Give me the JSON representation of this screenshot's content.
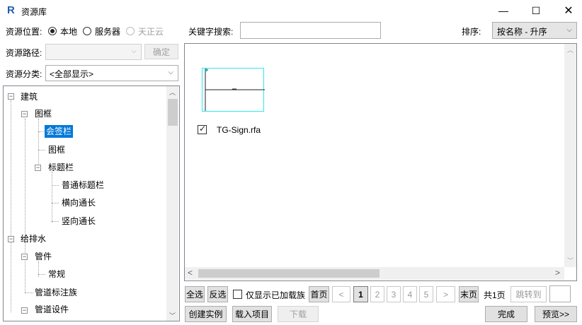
{
  "window": {
    "title": "资源库",
    "minimize": "—",
    "maximize": "☐",
    "close": "✕"
  },
  "location": {
    "label": "资源位置:",
    "options": [
      "本地",
      "服务器",
      "天正云"
    ],
    "selected": "本地"
  },
  "path": {
    "label": "资源路径:",
    "value": "",
    "confirm_label": "确定"
  },
  "category": {
    "label": "资源分类:",
    "value": "<全部显示>"
  },
  "tree": {
    "nodes": [
      {
        "label": "建筑",
        "expander": "⊟"
      },
      {
        "label": "图框",
        "expander": "⊟"
      },
      {
        "label": "会签栏"
      },
      {
        "label": "图框"
      },
      {
        "label": "标题栏",
        "expander": "⊟"
      },
      {
        "label": "普通标题栏"
      },
      {
        "label": "横向通长"
      },
      {
        "label": "竖向通长"
      },
      {
        "label": "给排水",
        "expander": "⊟"
      },
      {
        "label": "管件",
        "expander": "⊟"
      },
      {
        "label": "常规"
      },
      {
        "label": "管道标注族"
      },
      {
        "label": "管道设件"
      }
    ]
  },
  "search": {
    "label": "关键字搜索:",
    "value": ""
  },
  "sort": {
    "label": "排序:",
    "value": "按名称 - 升序"
  },
  "items": [
    {
      "filename": "TG-Sign.rfa",
      "checked": true
    }
  ],
  "pager": {
    "select_all": "全选",
    "invert": "反选",
    "only_loaded_label": "仅显示已加载族",
    "first": "首页",
    "prev": "<",
    "pages": [
      "1",
      "2",
      "3",
      "4",
      "5"
    ],
    "current_page": "1",
    "next": ">",
    "last": "末页",
    "total": "共1页",
    "jump": "跳转到"
  },
  "actions": {
    "create_instance": "创建实例",
    "load_project": "载入项目",
    "download": "下载",
    "done": "完成",
    "preview": "预览>>"
  }
}
